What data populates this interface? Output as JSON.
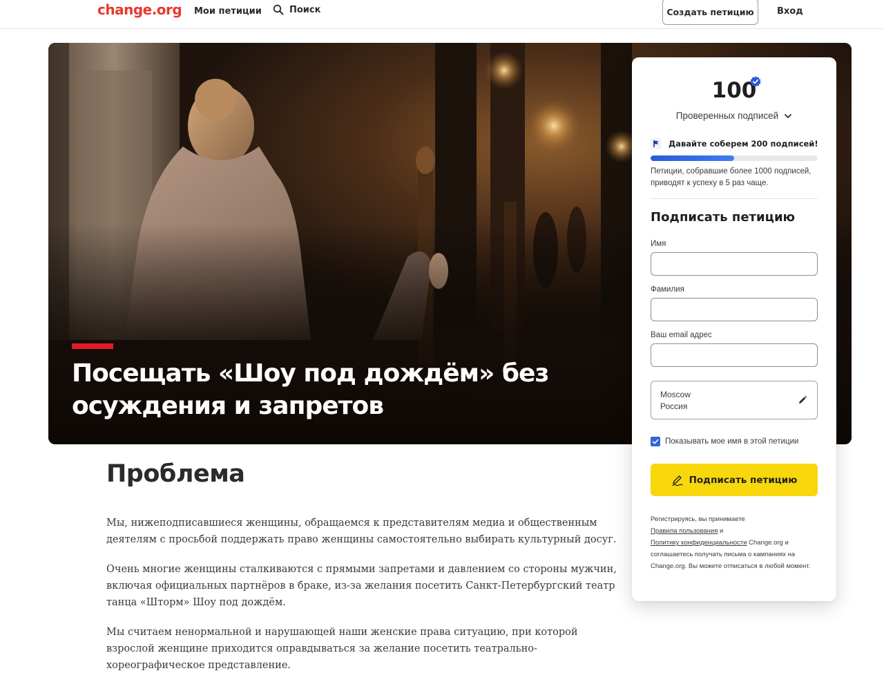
{
  "header": {
    "logo": "change.org",
    "nav_petitions": "Мои петиции",
    "nav_search": "Поиск",
    "create_button": "Создать петицию",
    "login": "Вход"
  },
  "hero": {
    "title": "Посещать «Шоу под дождём» без осуждения и запретов"
  },
  "sign_card": {
    "count": "100",
    "verified_label": "Проверенных подписей",
    "goal_text": "Давайте соберем 200 подписей!",
    "progress_fraction": 0.5,
    "hint": "Петиции, собравшие более 1000 подписей, приводят к успеху в 5 раз чаще.",
    "sign_title": "Подписать петицию",
    "first_name_label": "Имя",
    "last_name_label": "Фамилия",
    "email_label": "Ваш email адрес",
    "first_name_value": "",
    "last_name_value": "",
    "email_value": "",
    "location_city": "Moscow",
    "location_country": "Россия",
    "show_name_label": "Показывать мое имя в этой петиции",
    "show_name_checked": true,
    "sign_button": "Подписать петицию",
    "legal_intro": "Регистрируясь, вы принимаете",
    "legal_terms_link": "Правила пользования",
    "legal_and": "и",
    "legal_privacy_link": "Политику конфиденциальности",
    "legal_rest": "Change.org и соглашаетесь получать письма о кампаниях на Change.org. Вы можете отписаться в любой момент."
  },
  "problem": {
    "title": "Проблема",
    "p1": "Мы, нижеподписавшиеся женщины, обращаемся к представителям медиа и общественным деятелям с просьбой поддержать право женщины самостоятельно выбирать культурный досуг.",
    "p2": "Очень многие женщины сталкиваются с прямыми запретами и давлением со стороны мужчин, включая официальных партнёров в браке, из-за желания посетить Санкт-Петербургский театр танца «Шторм» Шоу под дождём.",
    "p3": "Мы считаем ненормальной и нарушающей наши женские права ситуацию, при которой взрослой женщине приходится оправдываться за желание посетить театрально-хореографическое представление."
  },
  "colors": {
    "brand": "#e8392e",
    "accent_yellow": "#f8d70c",
    "progress_blue": "#2a5bd7",
    "hero_accent": "#e11d21"
  }
}
